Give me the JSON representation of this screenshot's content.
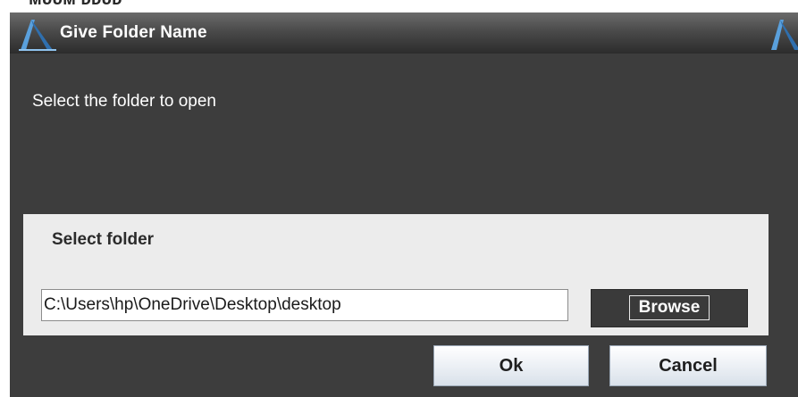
{
  "window": {
    "title": "Give Folder Name",
    "logo_icon": "app-logo-icon",
    "clipped_header_text": "ᴍᴜᴜᴍ ᴅᴅᴜᴅ"
  },
  "dialog": {
    "message": "Select the folder to open",
    "panel": {
      "label": "Select folder",
      "path_value": "C:\\Users\\hp\\OneDrive\\Desktop\\desktop",
      "browse_label": "Browse"
    },
    "buttons": {
      "ok_label": "Ok",
      "cancel_label": "Cancel"
    }
  },
  "colors": {
    "dialog_bg": "#3d3d3d",
    "panel_bg": "#ececec",
    "accent_logo": "#4a8fd0"
  }
}
